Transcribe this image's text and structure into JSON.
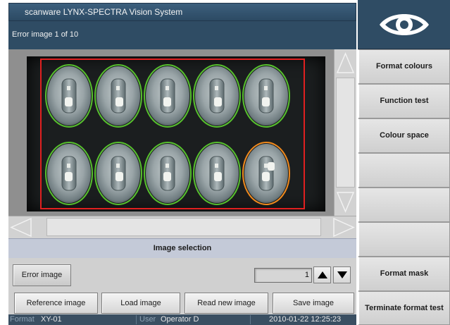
{
  "window": {
    "title": "scanware LYNX-SPECTRA Vision System"
  },
  "header": {
    "text": "Error image 1 of 10"
  },
  "viewer": {
    "grid_rows": 2,
    "grid_cols": 5,
    "ok_color": "#57c02e",
    "error_color": "#f08a1e",
    "roi_color": "#e02020",
    "error_index": 9
  },
  "selection": {
    "label": "Image selection"
  },
  "controls": {
    "error_image_label": "Error image",
    "counter_value": "1"
  },
  "bottom_buttons": [
    {
      "label": "Reference image"
    },
    {
      "label": "Load image"
    },
    {
      "label": "Read new image"
    },
    {
      "label": "Save image"
    }
  ],
  "status": {
    "format_label": "Format",
    "format_value": "XY-01",
    "user_label": "User",
    "user_value": "Operator D",
    "timestamp": "2010-01-22 12:25:23"
  },
  "sidebar": {
    "buttons": [
      {
        "label": "Format colours"
      },
      {
        "label": "Function test"
      },
      {
        "label": "Colour space"
      },
      {
        "label": ""
      },
      {
        "label": ""
      },
      {
        "label": ""
      },
      {
        "label": "Format mask"
      },
      {
        "label": "Terminate format test"
      }
    ]
  }
}
